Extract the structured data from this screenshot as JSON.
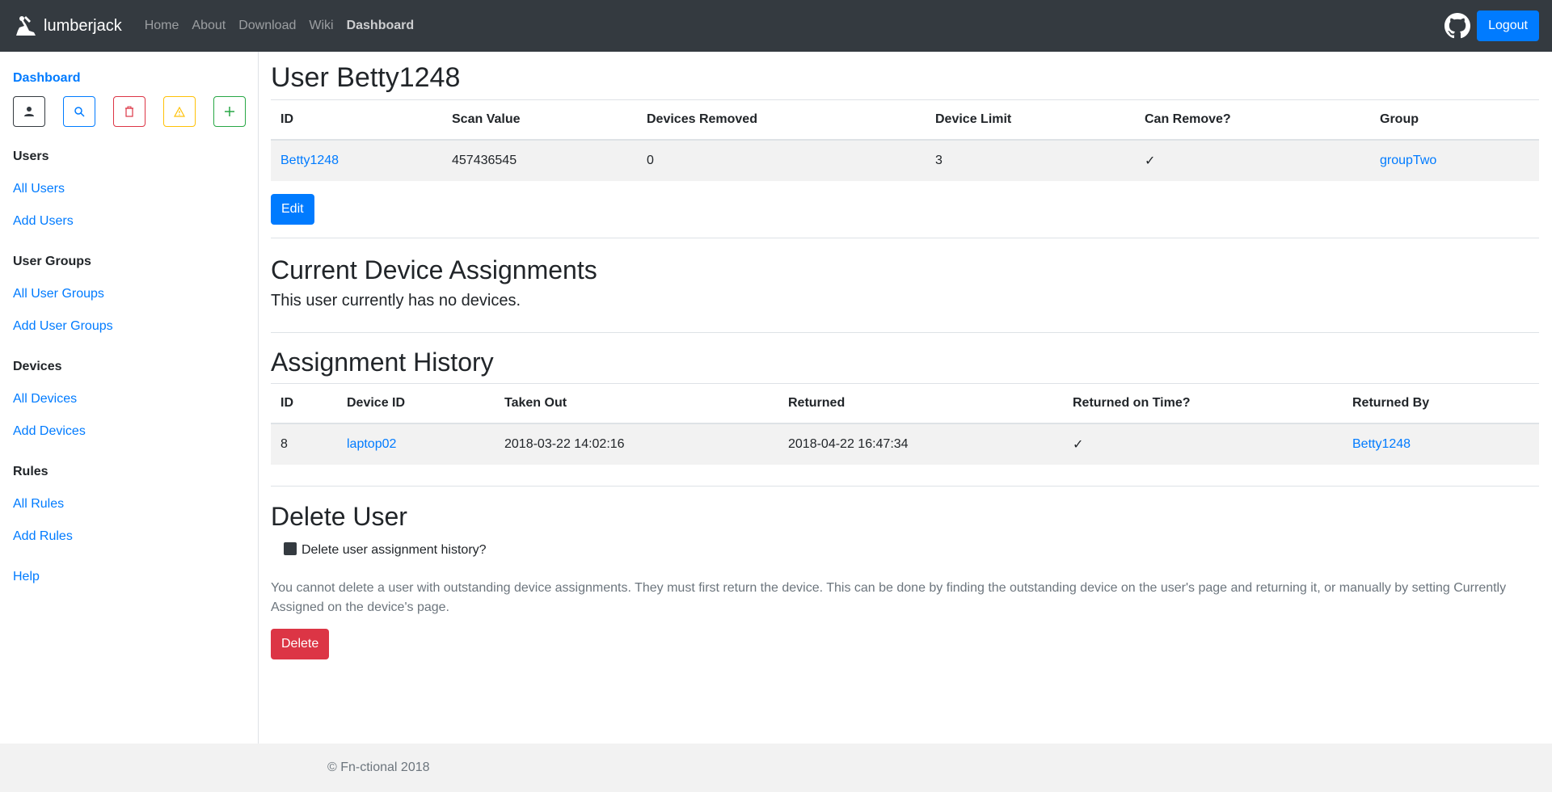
{
  "navbar": {
    "brand": "lumberjack",
    "links": [
      "Home",
      "About",
      "Download",
      "Wiki",
      "Dashboard"
    ],
    "logout_label": "Logout"
  },
  "sidebar": {
    "dashboard_label": "Dashboard",
    "quick_icons": [
      "user-icon",
      "search-icon",
      "trash-icon",
      "warning-icon",
      "plus-icon"
    ],
    "groups": [
      {
        "heading": "Users",
        "links": [
          "All Users",
          "Add Users"
        ]
      },
      {
        "heading": "User Groups",
        "links": [
          "All User Groups",
          "Add User Groups"
        ]
      },
      {
        "heading": "Devices",
        "links": [
          "All Devices",
          "Add Devices"
        ]
      },
      {
        "heading": "Rules",
        "links": [
          "All Rules",
          "Add Rules"
        ]
      }
    ],
    "help_label": "Help"
  },
  "main": {
    "title": "User Betty1248",
    "user_table": {
      "headers": [
        "ID",
        "Scan Value",
        "Devices Removed",
        "Device Limit",
        "Can Remove?",
        "Group"
      ],
      "row": [
        "Betty1248",
        "457436545",
        "0",
        "3",
        "✓",
        "groupTwo"
      ]
    },
    "edit_label": "Edit",
    "current_heading": "Current Device Assignments",
    "current_text": "This user currently has no devices.",
    "history_heading": "Assignment History",
    "history_table": {
      "headers": [
        "ID",
        "Device ID",
        "Taken Out",
        "Returned",
        "Returned on Time?",
        "Returned By"
      ],
      "row": [
        "8",
        "laptop02",
        "2018-03-22 14:02:16",
        "2018-04-22 16:47:34",
        "✓",
        "Betty1248"
      ]
    },
    "delete_heading": "Delete User",
    "delete_checkbox_label": "Delete user assignment history?",
    "delete_note": "You cannot delete a user with outstanding device assignments. They must first return the device. This can be done by finding the outstanding device on the user's page and returning it, or manually by setting Currently Assigned on the device's page.",
    "delete_label": "Delete"
  },
  "footer": {
    "text": "© Fn-ctional 2018"
  },
  "colors": {
    "navbar": "#343a40",
    "primary": "#007bff",
    "danger": "#dc3545",
    "warning": "#ffc107",
    "success": "#28a745"
  }
}
